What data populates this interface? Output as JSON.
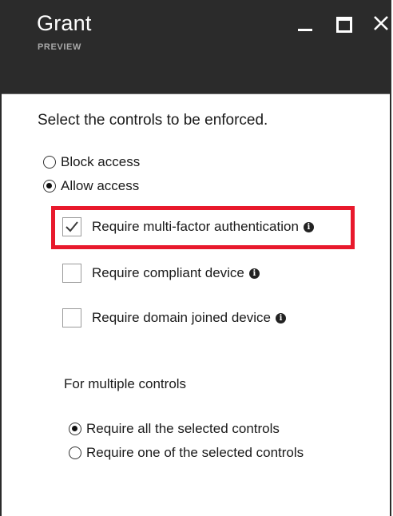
{
  "header": {
    "title": "Grant",
    "subtitle": "PREVIEW"
  },
  "window_controls": {
    "minimize_icon": "minimize-icon",
    "maximize_icon": "maximize-icon",
    "close_icon": "close-icon"
  },
  "prompt": "Select the controls to be enforced.",
  "access": {
    "options": [
      {
        "label": "Block access",
        "checked": false
      },
      {
        "label": "Allow access",
        "checked": true
      }
    ]
  },
  "controls": [
    {
      "label": "Require multi-factor authentication",
      "checked": true,
      "highlighted": true
    },
    {
      "label": "Require compliant device",
      "checked": false
    },
    {
      "label": "Require domain joined device",
      "checked": false
    }
  ],
  "multiple": {
    "label": "For multiple controls",
    "options": [
      {
        "label": "Require all the selected controls",
        "checked": true
      },
      {
        "label": "Require one of the selected controls",
        "checked": false
      }
    ]
  },
  "colors": {
    "header_bg": "#2b2b2b",
    "highlight_border": "#e8192c",
    "checkmark": "#3a3a3a"
  }
}
